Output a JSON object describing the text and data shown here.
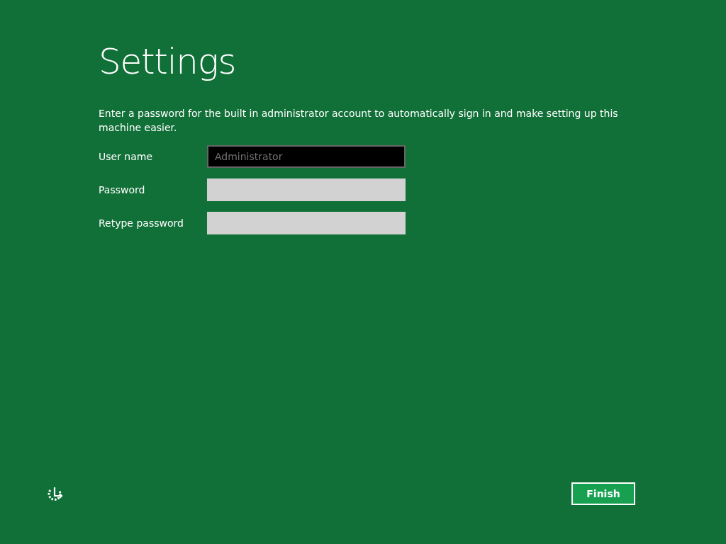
{
  "title": "Settings",
  "description": "Enter a password for the built in administrator account to automatically sign in and make setting up this machine easier.",
  "fields": [
    {
      "label": "User name",
      "value": "Administrator",
      "disabled": true
    },
    {
      "label": "Password",
      "disabled": false
    },
    {
      "label": "Retype password",
      "disabled": false
    }
  ],
  "buttons": [
    "Finish"
  ]
}
